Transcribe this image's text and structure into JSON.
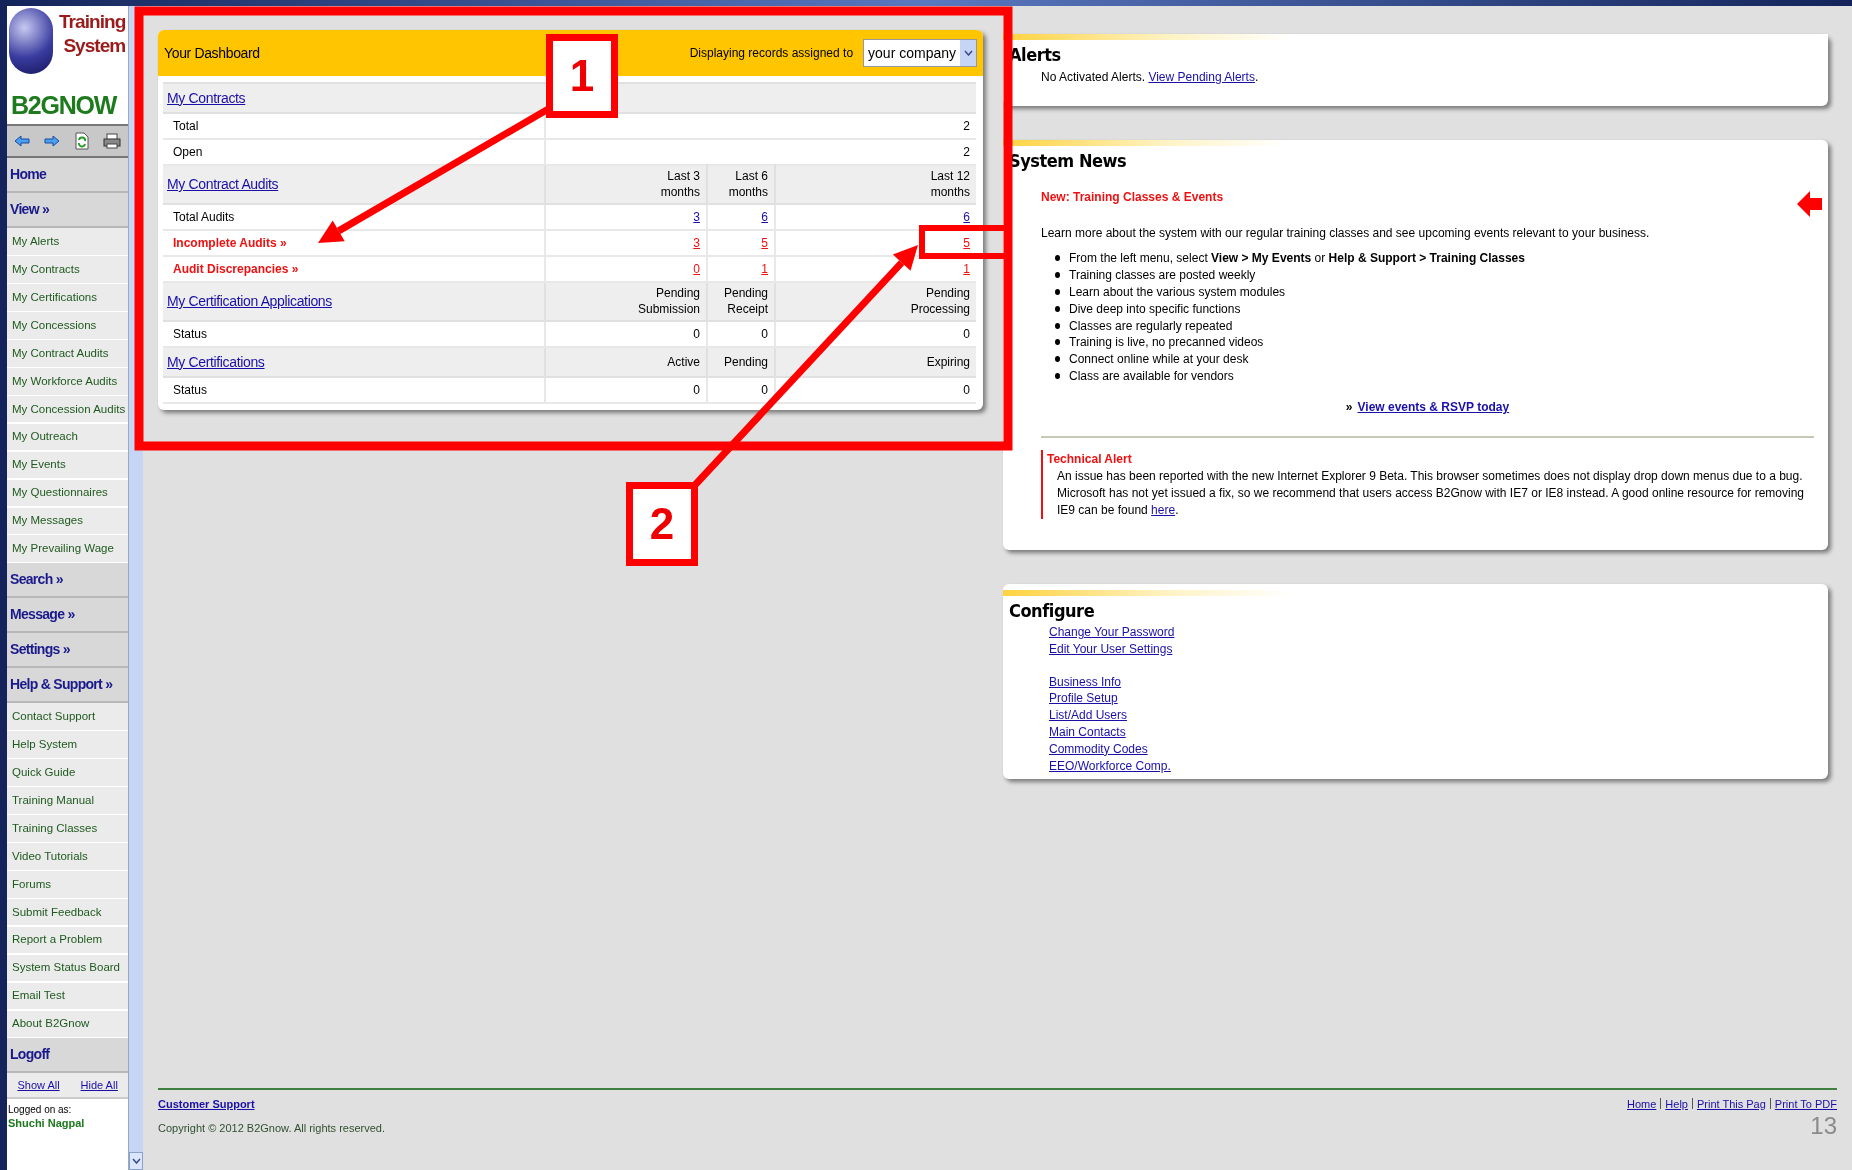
{
  "logo": {
    "title": "Training System",
    "brand": "B2GNOW"
  },
  "sidebar": {
    "sections": [
      {
        "title": "Home"
      },
      {
        "title": "View »",
        "items": [
          "My Alerts",
          "My Contracts",
          "My Certifications",
          "My Concessions",
          "My Contract Audits",
          "My Workforce Audits",
          "My Concession Audits",
          "My Outreach",
          "My Events",
          "My Questionnaires",
          "My Messages",
          "My Prevailing Wage"
        ]
      },
      {
        "title": "Search »"
      },
      {
        "title": "Message »"
      },
      {
        "title": "Settings »"
      },
      {
        "title": "Help & Support »",
        "items": [
          "Contact Support",
          "Help System",
          "Quick Guide",
          "Training Manual",
          "Training Classes",
          "Video Tutorials",
          "Forums",
          "Submit Feedback",
          "Report a Problem",
          "System Status Board",
          "Email Test",
          "About B2Gnow"
        ]
      },
      {
        "title": "Logoff"
      }
    ],
    "toggles": [
      "Show All",
      "Hide All"
    ],
    "logged_on_label": "Logged on as:",
    "user": "Shuchi Nagpal"
  },
  "dashboard": {
    "title": "Your Dashboard",
    "filter_label": "Displaying records assigned to",
    "filter_value": "your company",
    "sections": [
      {
        "title": "My Contracts",
        "rows": [
          {
            "label": "Total",
            "kind": "plain",
            "values": [
              {
                "text": "2",
                "link": false
              }
            ]
          },
          {
            "label": "Open",
            "kind": "plain",
            "values": [
              {
                "text": "2",
                "link": false
              }
            ]
          }
        ]
      },
      {
        "title": "My Contract Audits",
        "headers": [
          "Last 3 months",
          "Last 6 months",
          "Last 12 months"
        ],
        "rows": [
          {
            "label": "Total Audits",
            "kind": "plain",
            "values": [
              {
                "text": "3",
                "link": true
              },
              {
                "text": "6",
                "link": true
              },
              {
                "text": "6",
                "link": true
              }
            ]
          },
          {
            "label": "Incomplete Audits »",
            "kind": "alert",
            "values": [
              {
                "text": "3",
                "link": true
              },
              {
                "text": "5",
                "link": true
              },
              {
                "text": "5",
                "link": true
              }
            ]
          },
          {
            "label": "Audit Discrepancies »",
            "kind": "alert",
            "values": [
              {
                "text": "0",
                "link": true
              },
              {
                "text": "1",
                "link": true
              },
              {
                "text": "1",
                "link": true
              }
            ]
          }
        ]
      },
      {
        "title": "My Certification Applications",
        "headers": [
          "Pending Submission",
          "Pending Receipt",
          "Pending Processing"
        ],
        "rows": [
          {
            "label": "Status",
            "kind": "plain",
            "values": [
              {
                "text": "0",
                "link": false
              },
              {
                "text": "0",
                "link": false
              },
              {
                "text": "0",
                "link": false
              }
            ]
          }
        ]
      },
      {
        "title": "My Certifications",
        "headers": [
          "Active",
          "Pending",
          "Expiring"
        ],
        "rows": [
          {
            "label": "Status",
            "kind": "plain",
            "values": [
              {
                "text": "0",
                "link": false
              },
              {
                "text": "0",
                "link": false
              },
              {
                "text": "0",
                "link": false
              }
            ]
          }
        ]
      }
    ]
  },
  "alerts": {
    "title": "Alerts",
    "text": "No Activated Alerts.",
    "link": "View Pending Alerts",
    "suffix": "."
  },
  "system_news": {
    "title": "System News",
    "headline": "New: Training Classes & Events",
    "intro": "Learn more about the system with our regular training classes and see upcoming events relevant to your business.",
    "bullets": [
      "From the left menu, select **View > My Events** or **Help & Support > Training Classes**",
      "Training classes are posted weekly",
      "Learn about the various system modules",
      "Dive deep into specific functions",
      "Classes are regularly repeated",
      "Training is live, no precanned videos",
      "Connect online while at your desk",
      "Class are available for vendors"
    ],
    "cta_prefix": "»",
    "cta": "View events & RSVP today",
    "alert_title": "Technical Alert",
    "alert_text": "An issue has been reported with the new Internet Explorer 9 Beta. This browser sometimes does not display drop down menus due to a bug. Microsoft has not yet issued a fix, so we recommend that users access B2Gnow with IE7 or IE8 instead. A good online resource for removing IE9 can be found",
    "alert_link": "here",
    "alert_suffix": "."
  },
  "configure": {
    "title": "Configure",
    "groups": [
      [
        "Change Your Password",
        "Edit Your User Settings"
      ],
      [
        "Business Info",
        "Profile Setup",
        "List/Add Users",
        "Main Contacts",
        "Commodity Codes",
        "EEO/Workforce Comp."
      ]
    ]
  },
  "footer": {
    "support": "Customer Support",
    "copyright": "Copyright © 2012 B2Gnow. All rights reserved.",
    "links": [
      "Home",
      "Help",
      "Print This Pag",
      "Print To PDF"
    ]
  },
  "slide": {
    "callouts": [
      "1",
      "2"
    ],
    "page_number": "13"
  }
}
